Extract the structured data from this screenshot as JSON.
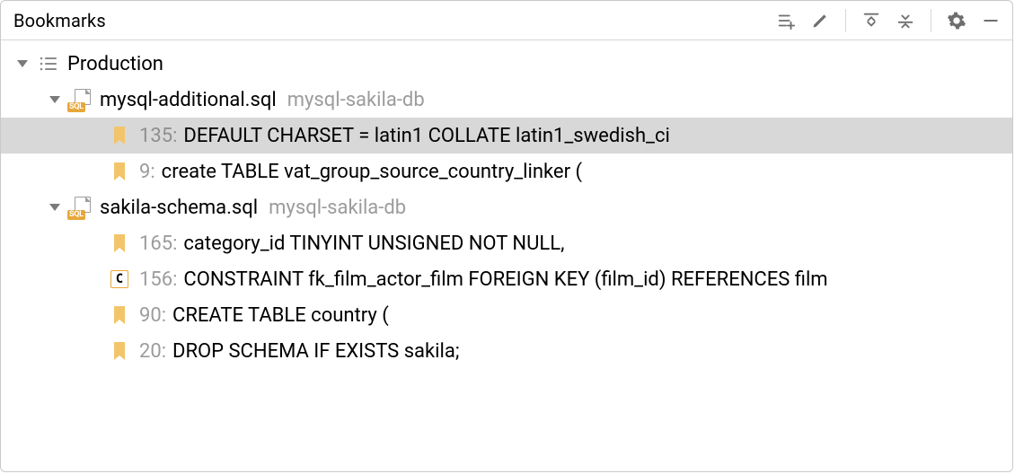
{
  "header": {
    "title": "Bookmarks"
  },
  "tree": {
    "root": {
      "label": "Production"
    },
    "files": [
      {
        "name": "mysql-additional.sql",
        "path": "mysql-sakila-db",
        "bookmarks": [
          {
            "line": "135:",
            "text": "DEFAULT CHARSET = latin1 COLLATE latin1_swedish_ci",
            "mnemonic": "",
            "selected": true
          },
          {
            "line": "9:",
            "text": "create TABLE vat_group_source_country_linker (",
            "mnemonic": "",
            "selected": false
          }
        ]
      },
      {
        "name": "sakila-schema.sql",
        "path": "mysql-sakila-db",
        "bookmarks": [
          {
            "line": "165:",
            "text": "category_id TINYINT UNSIGNED NOT NULL,",
            "mnemonic": "",
            "selected": false
          },
          {
            "line": "156:",
            "text": "CONSTRAINT fk_film_actor_film FOREIGN KEY (film_id) REFERENCES film",
            "mnemonic": "C",
            "selected": false
          },
          {
            "line": "90:",
            "text": "CREATE TABLE country (",
            "mnemonic": "",
            "selected": false
          },
          {
            "line": "20:",
            "text": "DROP SCHEMA IF EXISTS sakila;",
            "mnemonic": "",
            "selected": false
          }
        ]
      }
    ]
  }
}
